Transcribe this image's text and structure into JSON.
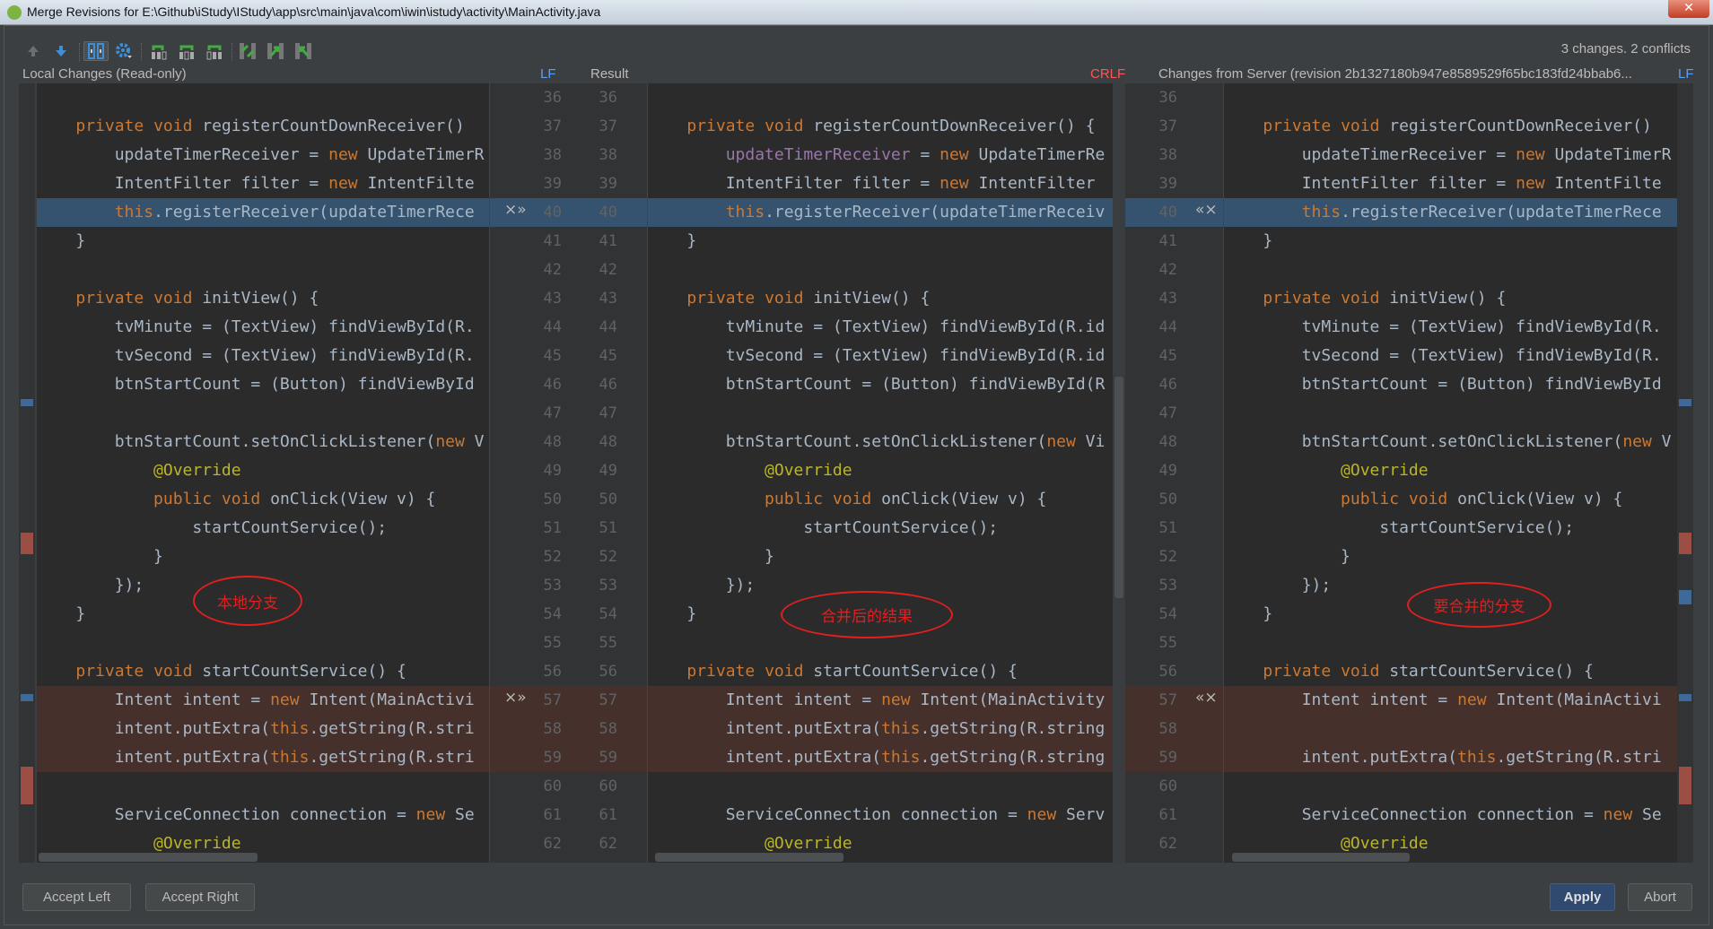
{
  "window": {
    "title": "Merge Revisions for E:\\Github\\iStudy\\IStudy\\app\\src\\main\\java\\com\\iwin\\istudy\\activity\\MainActivity.java",
    "close": "✕"
  },
  "toolbar": {
    "icons": [
      "prev-difference-icon",
      "next-difference-icon",
      "sync-scroll-icon",
      "settings-icon",
      "apply-non-conflicting-left-icon",
      "apply-non-conflicting-all-icon",
      "apply-non-conflicting-right-icon",
      "magic-resolve-icon",
      "accept-left-column-icon",
      "accept-right-column-icon"
    ],
    "status": "3 changes. 2 conflicts"
  },
  "headers": {
    "left": "Local Changes (Read-only)",
    "left_sep": "LF",
    "middle": "Result",
    "middle_sep": "CRLF",
    "right": "Changes from Server (revision 2b1327180b947e8589529f65bc183fd24bbab6...",
    "right_sep": "LF"
  },
  "colors": {
    "keyword": "#cc7832",
    "text": "#a9b7c6",
    "field": "#9876aa",
    "annotation": "#bbb529",
    "modified": "#35536e",
    "conflict": "#45302b",
    "lf": "#589df6",
    "crlf": "#ff5555",
    "note": "#e02020"
  },
  "first_line": 36,
  "changes": [
    {
      "type": "modified",
      "from": 40,
      "to": 40
    },
    {
      "type": "conflict",
      "from": 57,
      "to": 59
    }
  ],
  "markers": {
    "left": "×»",
    "right": "«×"
  },
  "panes": {
    "left": {
      "fields": [],
      "lines": [
        "",
        "    private void registerCountDownReceiver()",
        "        updateTimerReceiver = new UpdateTimerR",
        "        IntentFilter filter = new IntentFilte",
        "        this.registerReceiver(updateTimerRece",
        "    }",
        "",
        "    private void initView() {",
        "        tvMinute = (TextView) findViewById(R.",
        "        tvSecond = (TextView) findViewById(R.",
        "        btnStartCount = (Button) findViewById",
        "",
        "        btnStartCount.setOnClickListener(new V",
        "            @Override",
        "            public void onClick(View v) {",
        "                startCountService();",
        "            }",
        "        });",
        "    }",
        "",
        "    private void startCountService() {",
        "        Intent intent = new Intent(MainActivi",
        "        intent.putExtra(this.getString(R.stri",
        "        intent.putExtra(this.getString(R.stri",
        "",
        "        ServiceConnection connection = new Se",
        "            @Override"
      ]
    },
    "middle": {
      "fields": [
        "updateTimerReceiver"
      ],
      "lines": [
        "",
        "    private void registerCountDownReceiver() {",
        "        updateTimerReceiver = new UpdateTimerRe",
        "        IntentFilter filter = new IntentFilter",
        "        this.registerReceiver(updateTimerReceiv",
        "    }",
        "",
        "    private void initView() {",
        "        tvMinute = (TextView) findViewById(R.id",
        "        tvSecond = (TextView) findViewById(R.id",
        "        btnStartCount = (Button) findViewById(R",
        "",
        "        btnStartCount.setOnClickListener(new Vi",
        "            @Override",
        "            public void onClick(View v) {",
        "                startCountService();",
        "            }",
        "        });",
        "    }",
        "",
        "    private void startCountService() {",
        "        Intent intent = new Intent(MainActivity",
        "        intent.putExtra(this.getString(R.string",
        "        intent.putExtra(this.getString(R.string",
        "",
        "        ServiceConnection connection = new Serv",
        "            @Override"
      ]
    },
    "right": {
      "fields": [],
      "lines": [
        "",
        "    private void registerCountDownReceiver()",
        "        updateTimerReceiver = new UpdateTimerR",
        "        IntentFilter filter = new IntentFilte",
        "        this.registerReceiver(updateTimerRece",
        "    }",
        "",
        "    private void initView() {",
        "        tvMinute = (TextView) findViewById(R.",
        "        tvSecond = (TextView) findViewById(R.",
        "        btnStartCount = (Button) findViewById",
        "",
        "        btnStartCount.setOnClickListener(new V",
        "            @Override",
        "            public void onClick(View v) {",
        "                startCountService();",
        "            }",
        "        });",
        "    }",
        "",
        "    private void startCountService() {",
        "        Intent intent = new Intent(MainActivi",
        "",
        "        intent.putExtra(this.getString(R.stri",
        "",
        "        ServiceConnection connection = new Se",
        "            @Override"
      ]
    }
  },
  "annotations": {
    "left": "本地分支",
    "middle": "合并后的结果",
    "right": "要合并的分支"
  },
  "buttons": {
    "accept_left": "Accept Left",
    "accept_right": "Accept Right",
    "apply": "Apply",
    "abort": "Abort"
  }
}
